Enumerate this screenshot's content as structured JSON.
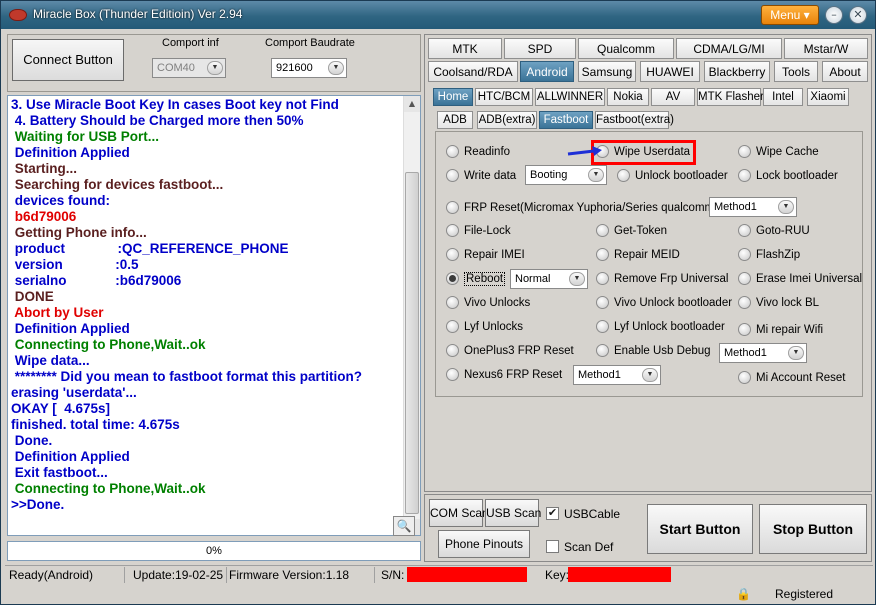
{
  "window": {
    "title": "Miracle Box (Thunder Editioin) Ver 2.94",
    "menu_label": "Menu",
    "menu_arrow": "▾"
  },
  "connect": {
    "button_label": "Connect Button",
    "comport_label": "Comport inf",
    "comport_value": "COM40",
    "baud_label": "Comport Baudrate",
    "baud_value": "921600"
  },
  "log": {
    "lines": [
      {
        "text": "3. Use Miracle Boot Key In cases Boot key not Find",
        "color": "#0000c8"
      },
      {
        "text": " 4. Battery Should be Charged more then 50%",
        "color": "#0000c8"
      },
      {
        "text": " Waiting for USB Port...",
        "color": "#008000"
      },
      {
        "text": " Definition Applied",
        "color": "#0000c8"
      },
      {
        "text": " Starting...",
        "color": "#5a1f1f"
      },
      {
        "text": " Searching for devices fastboot...",
        "color": "#5a1f1f"
      },
      {
        "text": " devices found:",
        "color": "#0000c8"
      },
      {
        "text": " b6d79006",
        "color": "#e00000"
      },
      {
        "text": " Getting Phone info...",
        "color": "#5a1f1f"
      },
      {
        "text": " product              :QC_REFERENCE_PHONE",
        "color": "#0000c8"
      },
      {
        "text": " version              :0.5",
        "color": "#0000c8"
      },
      {
        "text": " serialno             :b6d79006",
        "color": "#0000c8"
      },
      {
        "text": " DONE",
        "color": "#5a1f1f"
      },
      {
        "text": " Abort by User",
        "color": "#e00000"
      },
      {
        "text": " Definition Applied",
        "color": "#0000c8"
      },
      {
        "text": " Connecting to Phone,Wait..ok",
        "color": "#008000"
      },
      {
        "text": " Wipe data...",
        "color": "#0000c8"
      },
      {
        "text": " ******** Did you mean to fastboot format this partition?",
        "color": "#0000c8"
      },
      {
        "text": "erasing 'userdata'...",
        "color": "#0000c8"
      },
      {
        "text": "OKAY [  4.675s]",
        "color": "#0000c8"
      },
      {
        "text": "finished. total time: 4.675s",
        "color": "#0000c8"
      },
      {
        "text": " Done.",
        "color": "#0000c8"
      },
      {
        "text": " Definition Applied",
        "color": "#0000c8"
      },
      {
        "text": " Exit fastboot...",
        "color": "#0000c8"
      },
      {
        "text": " Connecting to Phone,Wait..ok",
        "color": "#008000"
      },
      {
        "text": ">>Done.",
        "color": "#0000c8"
      }
    ]
  },
  "progress": {
    "text": "0%",
    "value": 0
  },
  "status": {
    "state": "Ready(Android)",
    "update": "Update:19-02-25",
    "firmware": "Firmware Version:1.18",
    "sn_label": "S/N:",
    "key_label": "Key:",
    "registered": "Registered"
  },
  "tabs_row1": [
    "MTK",
    "SPD",
    "Qualcomm",
    "CDMA/LG/MI",
    "Mstar/W"
  ],
  "tabs_row2": [
    "Coolsand/RDA",
    "Android",
    "Samsung",
    "HUAWEI",
    "Blackberry",
    "Tools",
    "About"
  ],
  "tabs_row3": [
    "Home",
    "HTC/BCM",
    "ALLWINNER",
    "Nokia",
    "AV",
    "MTK Flasher",
    "Intel",
    "Xiaomi"
  ],
  "tabs_row4": [
    "ADB",
    "ADB(extra)",
    "Fastboot",
    "Fastboot(extra)"
  ],
  "options": {
    "readinfo": "Readinfo",
    "wipe_userdata": "Wipe Userdata",
    "wipe_cache": "Wipe Cache",
    "write_data": "Write data",
    "write_data_mode": "Booting",
    "unlock_bootloader": "Unlock bootloader",
    "lock_bootloader": "Lock bootloader",
    "frp_reset": "FRP Reset(Micromax  Yuphoria/Series qualcomm)",
    "frp_method": "Method1",
    "file_lock": "File-Lock",
    "get_token": "Get-Token",
    "goto_ruu": "Goto-RUU",
    "repair_imei": "Repair IMEI",
    "repair_meid": "Repair MEID",
    "flashzip": "FlashZip",
    "reboot": "Reboot",
    "reboot_mode": "Normal",
    "remove_frp_universal": "Remove Frp Universal",
    "erase_imei_universal": "Erase Imei Universal",
    "vivo_unlocks": "Vivo Unlocks",
    "vivo_unlock_bootloader": "Vivo Unlock bootloader",
    "vivo_lock_bl": "Vivo lock BL",
    "lyf_unlocks": "Lyf Unlocks",
    "lyf_unlock_bootloader": "Lyf Unlock bootloader",
    "mi_repair_wifi": "Mi repair Wifi",
    "oneplus3_frp": "OnePlus3 FRP Reset",
    "enable_usb_debug": "Enable Usb Debug",
    "usb_debug_method": "Method1",
    "nexus6_frp": "Nexus6 FRP Reset",
    "nexus6_method": "Method1",
    "mi_account_reset": "Mi Account Reset"
  },
  "bottom": {
    "com_scan": "COM Scan",
    "usb_scan": "USB Scan",
    "usb_cable": "USBCable",
    "usb_cable_checked": true,
    "phone_pinouts": "Phone Pinouts",
    "scan_def": "Scan Def",
    "scan_def_checked": false,
    "start_button": "Start Button",
    "stop_button": "Stop Button"
  }
}
